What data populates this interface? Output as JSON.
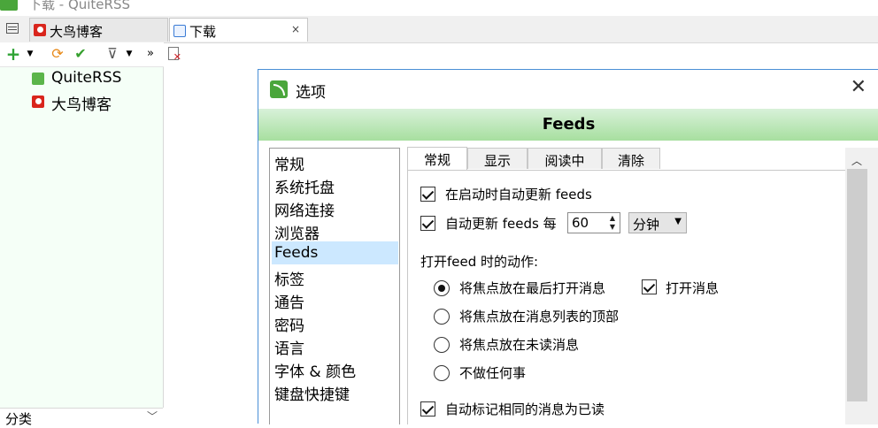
{
  "window": {
    "title": "下载 - QuiteRSS"
  },
  "tabs": [
    {
      "label": "大鸟博客",
      "active": false
    },
    {
      "label": "下载",
      "active": true,
      "close": "×"
    }
  ],
  "toolbar": {
    "add": "+",
    "add_dd": "▼",
    "update": "⟳",
    "mark_read": "✔",
    "filter": "⊽",
    "filter_dd": "▼",
    "more": "»"
  },
  "feeds": [
    {
      "label": "QuiteRSS",
      "icon": "rss-icon"
    },
    {
      "label": "大鸟博客",
      "icon": "favicon-red"
    }
  ],
  "categories_label": "分类",
  "dialog": {
    "title": "选项",
    "close": "✕",
    "section_title": "Feeds",
    "categories": [
      "常规",
      "系统托盘",
      "网络连接",
      "浏览器",
      "Feeds",
      "标签",
      "通告",
      "密码",
      "语言",
      "字体 & 颜色",
      "键盘快捷键"
    ],
    "selected_category": "Feeds",
    "tabs": [
      "常规",
      "显示",
      "阅读中",
      "清除"
    ],
    "active_tab": "常规",
    "general": {
      "update_on_start": {
        "label": "在启动时自动更新 feeds",
        "checked": true
      },
      "auto_update": {
        "label": "自动更新 feeds 每",
        "checked": true,
        "value": "60",
        "unit": "分钟"
      },
      "open_feed_action_label": "打开feed 时的动作:",
      "radio_options": [
        {
          "label": "将焦点放在最后打开消息",
          "checked": true
        },
        {
          "label": "将焦点放在消息列表的顶部",
          "checked": false
        },
        {
          "label": "将焦点放在未读消息",
          "checked": false
        },
        {
          "label": "不做任何事",
          "checked": false
        }
      ],
      "open_message": {
        "label": "打开消息",
        "checked": true
      },
      "mark_same_read": {
        "label": "自动标记相同的消息为已读",
        "checked": true
      }
    }
  },
  "colors": {
    "banner_top": "#d8f1d9",
    "banner_bottom": "#a7df9f",
    "selection": "#cce8ff",
    "feeds_bg": "#f5fff7"
  }
}
